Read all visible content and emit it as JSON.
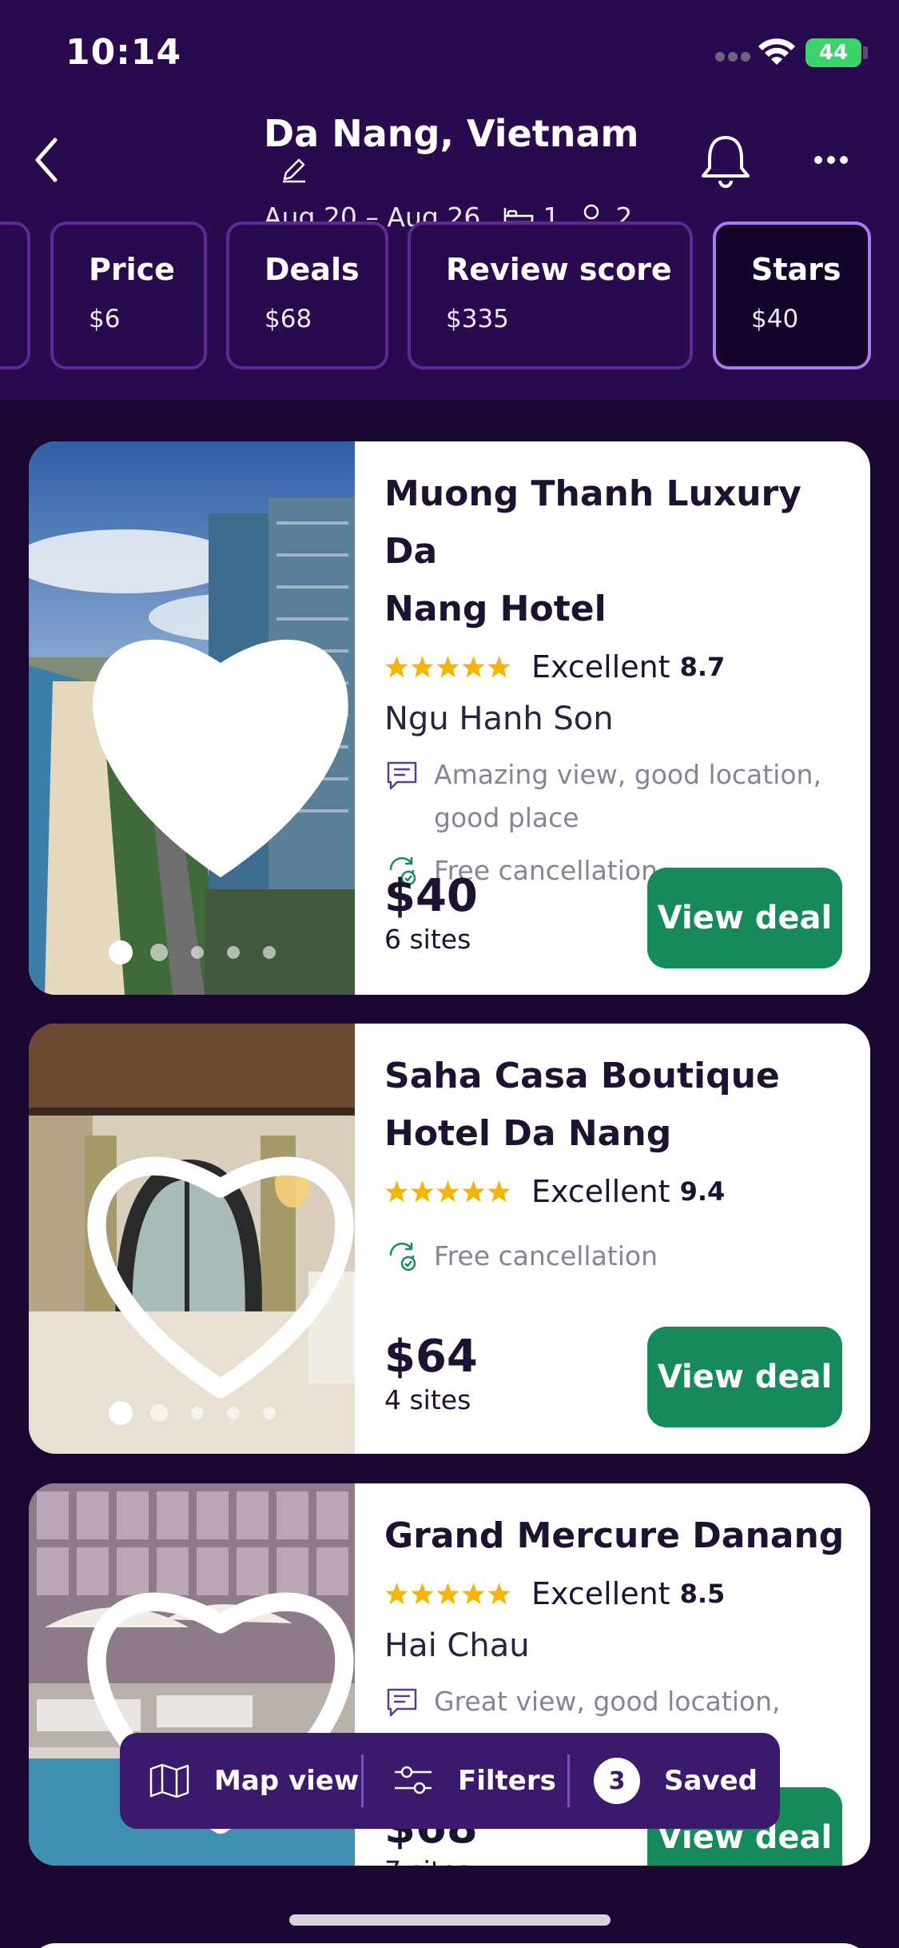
{
  "status_bar": {
    "time": "10:14",
    "battery": "44"
  },
  "header": {
    "title": "Da Nang, Vietnam",
    "dates": "Aug 20 – Aug 26",
    "rooms": "1",
    "guests": "2"
  },
  "filters": [
    {
      "label": "Price",
      "value": "$6"
    },
    {
      "label": "Deals",
      "value": "$68"
    },
    {
      "label": "Review score",
      "value": "$335"
    },
    {
      "label": "Stars",
      "value": "$40",
      "active": true
    }
  ],
  "hotels": [
    {
      "name_line1": "Muong Thanh Luxury Da",
      "name_line2": "Nang Hotel",
      "rating_word": "Excellent",
      "rating": "8.7",
      "area": "Ngu Hanh Son",
      "review_line1": "Amazing view, good location,",
      "review_line2": "good place",
      "cancellation": "Free cancellation",
      "price": "$40",
      "sites": "6 sites",
      "cta": "View deal",
      "favorited": true
    },
    {
      "name_line1": "Saha Casa Boutique",
      "name_line2": "Hotel Da Nang",
      "rating_word": "Excellent",
      "rating": "9.4",
      "cancellation": "Free cancellation",
      "price": "$64",
      "sites": "4 sites",
      "cta": "View deal",
      "favorited": false
    },
    {
      "name_line1": "Grand Mercure Danang",
      "rating_word": "Excellent",
      "rating": "8.5",
      "area": "Hai Chau",
      "review_line1": "Great view, good location,",
      "price": "$68",
      "sites": "7 sites",
      "cta": "View deal",
      "favorited": false
    }
  ],
  "bottom_bar": {
    "map_label": "Map view",
    "filters_label": "Filters",
    "saved_count": "3",
    "saved_label": "Saved"
  },
  "colors": {
    "header_bg": "#2a0a4e",
    "page_bg": "#1a0633",
    "chip_border": "#5d2a94",
    "chip_active_border": "#a97cf0",
    "cta_green": "#178a5c",
    "star_gold": "#f5b40a",
    "bottom_bar": "#3b1a6c"
  },
  "icons": [
    "back-icon",
    "edit-icon",
    "bed-icon",
    "guest-icon",
    "bell-icon",
    "more-icon",
    "heart-icon",
    "review-icon",
    "cancellation-icon",
    "map-icon",
    "filters-icon"
  ]
}
